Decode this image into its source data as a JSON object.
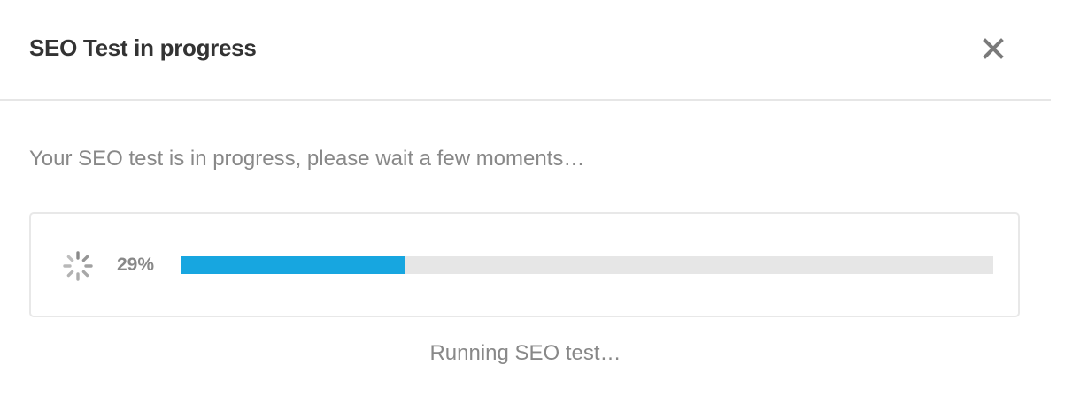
{
  "dialog": {
    "title": "SEO Test in progress",
    "close_icon": "close-icon"
  },
  "body": {
    "message": "Your SEO test is in progress, please wait a few moments…",
    "progress": {
      "percent_label": "29%",
      "value": 0.277,
      "spinner_icon": "spinner-icon",
      "fill_color": "#17a6e0",
      "track_color": "#e6e6e6"
    },
    "status": "Running SEO test…"
  }
}
